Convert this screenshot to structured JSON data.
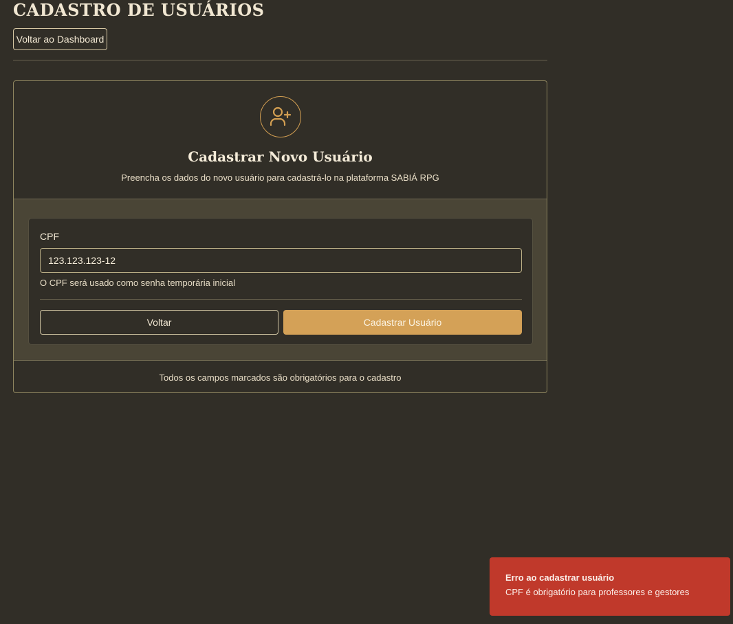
{
  "page": {
    "title": "CADASTRO DE USUÁRIOS",
    "back_dashboard_label": "Voltar ao Dashboard"
  },
  "card": {
    "icon": "user-plus-icon",
    "title": "Cadastrar Novo Usuário",
    "subtitle": "Preencha os dados do novo usuário para cadastrá-lo na plataforma SABIÁ RPG",
    "footer": "Todos os campos marcados são obrigatórios para o cadastro"
  },
  "form": {
    "cpf_label": "CPF",
    "cpf_value": "123.123.123-12",
    "cpf_hint": "O CPF será usado como senha temporária inicial",
    "back_label": "Voltar",
    "submit_label": "Cadastrar Usuário"
  },
  "toast": {
    "title": "Erro ao cadastrar usuário",
    "message": "CPF é obrigatório para professores e gestores",
    "color": "#c0392b"
  },
  "colors": {
    "background": "#312e27",
    "accent": "#d4a157",
    "panel": "#4a4536"
  }
}
